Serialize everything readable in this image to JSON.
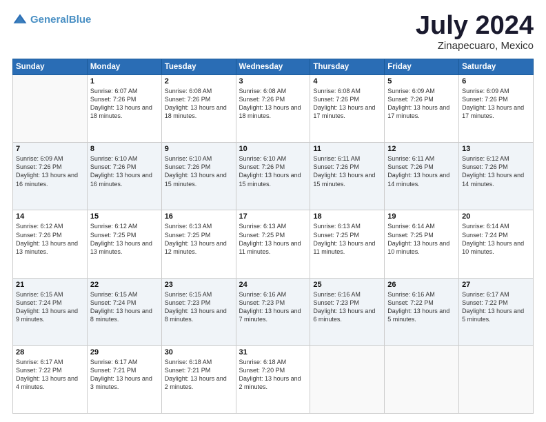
{
  "header": {
    "logo_line1": "General",
    "logo_line2": "Blue",
    "month": "July 2024",
    "location": "Zinapecuaro, Mexico"
  },
  "weekdays": [
    "Sunday",
    "Monday",
    "Tuesday",
    "Wednesday",
    "Thursday",
    "Friday",
    "Saturday"
  ],
  "weeks": [
    [
      {
        "day": "",
        "sunrise": "",
        "sunset": "",
        "daylight": ""
      },
      {
        "day": "1",
        "sunrise": "Sunrise: 6:07 AM",
        "sunset": "Sunset: 7:26 PM",
        "daylight": "Daylight: 13 hours and 18 minutes."
      },
      {
        "day": "2",
        "sunrise": "Sunrise: 6:08 AM",
        "sunset": "Sunset: 7:26 PM",
        "daylight": "Daylight: 13 hours and 18 minutes."
      },
      {
        "day": "3",
        "sunrise": "Sunrise: 6:08 AM",
        "sunset": "Sunset: 7:26 PM",
        "daylight": "Daylight: 13 hours and 18 minutes."
      },
      {
        "day": "4",
        "sunrise": "Sunrise: 6:08 AM",
        "sunset": "Sunset: 7:26 PM",
        "daylight": "Daylight: 13 hours and 17 minutes."
      },
      {
        "day": "5",
        "sunrise": "Sunrise: 6:09 AM",
        "sunset": "Sunset: 7:26 PM",
        "daylight": "Daylight: 13 hours and 17 minutes."
      },
      {
        "day": "6",
        "sunrise": "Sunrise: 6:09 AM",
        "sunset": "Sunset: 7:26 PM",
        "daylight": "Daylight: 13 hours and 17 minutes."
      }
    ],
    [
      {
        "day": "7",
        "sunrise": "Sunrise: 6:09 AM",
        "sunset": "Sunset: 7:26 PM",
        "daylight": "Daylight: 13 hours and 16 minutes."
      },
      {
        "day": "8",
        "sunrise": "Sunrise: 6:10 AM",
        "sunset": "Sunset: 7:26 PM",
        "daylight": "Daylight: 13 hours and 16 minutes."
      },
      {
        "day": "9",
        "sunrise": "Sunrise: 6:10 AM",
        "sunset": "Sunset: 7:26 PM",
        "daylight": "Daylight: 13 hours and 15 minutes."
      },
      {
        "day": "10",
        "sunrise": "Sunrise: 6:10 AM",
        "sunset": "Sunset: 7:26 PM",
        "daylight": "Daylight: 13 hours and 15 minutes."
      },
      {
        "day": "11",
        "sunrise": "Sunrise: 6:11 AM",
        "sunset": "Sunset: 7:26 PM",
        "daylight": "Daylight: 13 hours and 15 minutes."
      },
      {
        "day": "12",
        "sunrise": "Sunrise: 6:11 AM",
        "sunset": "Sunset: 7:26 PM",
        "daylight": "Daylight: 13 hours and 14 minutes."
      },
      {
        "day": "13",
        "sunrise": "Sunrise: 6:12 AM",
        "sunset": "Sunset: 7:26 PM",
        "daylight": "Daylight: 13 hours and 14 minutes."
      }
    ],
    [
      {
        "day": "14",
        "sunrise": "Sunrise: 6:12 AM",
        "sunset": "Sunset: 7:26 PM",
        "daylight": "Daylight: 13 hours and 13 minutes."
      },
      {
        "day": "15",
        "sunrise": "Sunrise: 6:12 AM",
        "sunset": "Sunset: 7:25 PM",
        "daylight": "Daylight: 13 hours and 13 minutes."
      },
      {
        "day": "16",
        "sunrise": "Sunrise: 6:13 AM",
        "sunset": "Sunset: 7:25 PM",
        "daylight": "Daylight: 13 hours and 12 minutes."
      },
      {
        "day": "17",
        "sunrise": "Sunrise: 6:13 AM",
        "sunset": "Sunset: 7:25 PM",
        "daylight": "Daylight: 13 hours and 11 minutes."
      },
      {
        "day": "18",
        "sunrise": "Sunrise: 6:13 AM",
        "sunset": "Sunset: 7:25 PM",
        "daylight": "Daylight: 13 hours and 11 minutes."
      },
      {
        "day": "19",
        "sunrise": "Sunrise: 6:14 AM",
        "sunset": "Sunset: 7:25 PM",
        "daylight": "Daylight: 13 hours and 10 minutes."
      },
      {
        "day": "20",
        "sunrise": "Sunrise: 6:14 AM",
        "sunset": "Sunset: 7:24 PM",
        "daylight": "Daylight: 13 hours and 10 minutes."
      }
    ],
    [
      {
        "day": "21",
        "sunrise": "Sunrise: 6:15 AM",
        "sunset": "Sunset: 7:24 PM",
        "daylight": "Daylight: 13 hours and 9 minutes."
      },
      {
        "day": "22",
        "sunrise": "Sunrise: 6:15 AM",
        "sunset": "Sunset: 7:24 PM",
        "daylight": "Daylight: 13 hours and 8 minutes."
      },
      {
        "day": "23",
        "sunrise": "Sunrise: 6:15 AM",
        "sunset": "Sunset: 7:23 PM",
        "daylight": "Daylight: 13 hours and 8 minutes."
      },
      {
        "day": "24",
        "sunrise": "Sunrise: 6:16 AM",
        "sunset": "Sunset: 7:23 PM",
        "daylight": "Daylight: 13 hours and 7 minutes."
      },
      {
        "day": "25",
        "sunrise": "Sunrise: 6:16 AM",
        "sunset": "Sunset: 7:23 PM",
        "daylight": "Daylight: 13 hours and 6 minutes."
      },
      {
        "day": "26",
        "sunrise": "Sunrise: 6:16 AM",
        "sunset": "Sunset: 7:22 PM",
        "daylight": "Daylight: 13 hours and 5 minutes."
      },
      {
        "day": "27",
        "sunrise": "Sunrise: 6:17 AM",
        "sunset": "Sunset: 7:22 PM",
        "daylight": "Daylight: 13 hours and 5 minutes."
      }
    ],
    [
      {
        "day": "28",
        "sunrise": "Sunrise: 6:17 AM",
        "sunset": "Sunset: 7:22 PM",
        "daylight": "Daylight: 13 hours and 4 minutes."
      },
      {
        "day": "29",
        "sunrise": "Sunrise: 6:17 AM",
        "sunset": "Sunset: 7:21 PM",
        "daylight": "Daylight: 13 hours and 3 minutes."
      },
      {
        "day": "30",
        "sunrise": "Sunrise: 6:18 AM",
        "sunset": "Sunset: 7:21 PM",
        "daylight": "Daylight: 13 hours and 2 minutes."
      },
      {
        "day": "31",
        "sunrise": "Sunrise: 6:18 AM",
        "sunset": "Sunset: 7:20 PM",
        "daylight": "Daylight: 13 hours and 2 minutes."
      },
      {
        "day": "",
        "sunrise": "",
        "sunset": "",
        "daylight": ""
      },
      {
        "day": "",
        "sunrise": "",
        "sunset": "",
        "daylight": ""
      },
      {
        "day": "",
        "sunrise": "",
        "sunset": "",
        "daylight": ""
      }
    ]
  ]
}
